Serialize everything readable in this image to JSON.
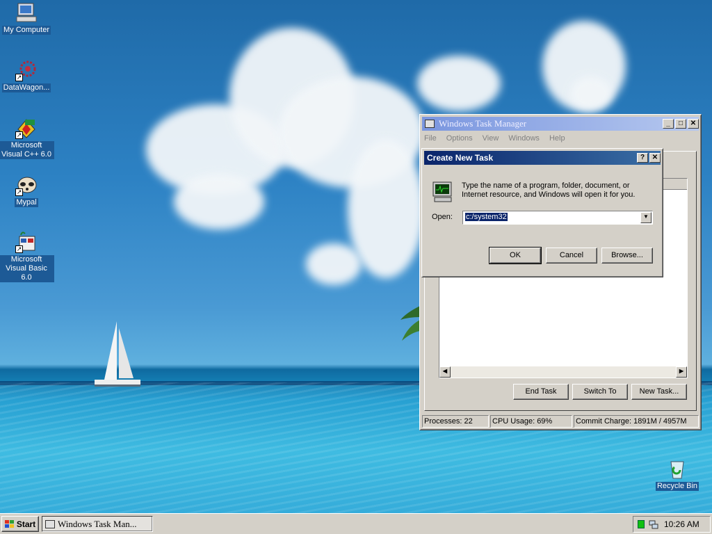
{
  "desktop": {
    "icons": [
      {
        "label": "My Computer",
        "icon": "my-computer-icon"
      },
      {
        "label": "DataWagon...",
        "icon": "datawagon-icon"
      },
      {
        "label": "Microsoft Visual C++ 6.0",
        "icon": "visual-cpp-icon"
      },
      {
        "label": "Mypal",
        "icon": "mypal-icon"
      },
      {
        "label": "Microsoft Visual Basic 6.0",
        "icon": "visual-basic-icon"
      }
    ],
    "recycle_bin": {
      "label": "Recycle Bin",
      "icon": "recycle-bin-icon"
    }
  },
  "task_manager": {
    "title": "Windows Task Manager",
    "menu": [
      "File",
      "Options",
      "View",
      "Windows",
      "Help"
    ],
    "buttons": {
      "end_task": "End Task",
      "switch_to": "Switch To",
      "new_task": "New Task..."
    },
    "status": {
      "processes": "Processes: 22",
      "cpu": "CPU Usage: 69%",
      "commit": "Commit Charge: 1891M / 4957M"
    }
  },
  "dialog": {
    "title": "Create New Task",
    "help_button": "?",
    "close_button": "✕",
    "message": "Type the name of a program, folder, document, or Internet resource, and Windows will open it for you.",
    "open_label": "Open:",
    "open_value": "c:/system32",
    "ok": "OK",
    "cancel": "Cancel",
    "browse": "Browse..."
  },
  "taskbar": {
    "start": "Start",
    "task_button": "Windows Task Man...",
    "clock": "10:26 AM"
  },
  "colors": {
    "title_active": "#0a246a",
    "title_inactive": "#7a96df",
    "face": "#d4d0c8"
  }
}
